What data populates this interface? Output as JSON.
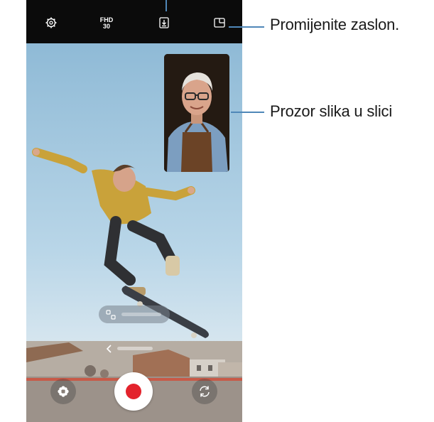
{
  "top_bar": {
    "quality_line1": "FHD",
    "quality_line2": "30",
    "icons": [
      "gear-icon",
      "video-quality-label",
      "save-download-icon",
      "screen-layout-icon"
    ]
  },
  "callouts": {
    "change_screen": "Promijenite zaslon.",
    "pip_window": "Prozor slika u slici"
  },
  "colors": {
    "accent_line": "#4f87b8",
    "record_red": "#e3232c",
    "top_bar": "#0b0b0b"
  }
}
